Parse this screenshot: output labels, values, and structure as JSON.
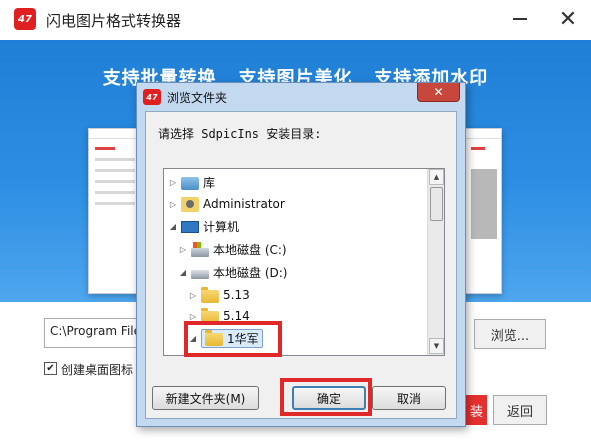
{
  "main_window": {
    "logo_text": "47",
    "title": "闪电图片格式转换器",
    "minimize_icon": "minimize-icon",
    "close_icon": "close-icon",
    "close_glyph": "✕",
    "banner": {
      "slogan": "支持批量转换   支持图片美化   支持添加水印"
    },
    "install_path": "C:\\Program File",
    "browse_label": "浏览...",
    "desktop_icon_checked": true,
    "desktop_icon_check_glyph": "✔",
    "desktop_icon_label": "创建桌面图标",
    "install_label": "装",
    "back_label": "返回",
    "accent_color": "#e53030",
    "banner_color": "#2d8ee3"
  },
  "browse_dialog": {
    "logo_text": "47",
    "title": "浏览文件夹",
    "close_glyph": "✕",
    "prompt": "请选择 SdpicIns 安装目录:",
    "tree": [
      {
        "expander": "▷",
        "icon": "library-icon",
        "label": "库"
      },
      {
        "expander": "▷",
        "icon": "user-folder-icon",
        "label": "Administrator"
      },
      {
        "expander": "◢",
        "icon": "computer-icon",
        "label": "计算机"
      },
      {
        "expander": "▷",
        "icon": "system-drive-icon",
        "label": "本地磁盘 (C:)"
      },
      {
        "expander": "◢",
        "icon": "drive-icon",
        "label": "本地磁盘 (D:)"
      },
      {
        "expander": "▷",
        "icon": "folder-icon",
        "label": "5.13"
      },
      {
        "expander": "▷",
        "icon": "folder-icon",
        "label": "5.14"
      },
      {
        "expander": "◢",
        "icon": "folder-icon",
        "label": "1华军",
        "selected": true
      }
    ],
    "scroll_up_glyph": "▲",
    "scroll_down_glyph": "▼",
    "new_folder_label": "新建文件夹(M)",
    "ok_label": "确定",
    "cancel_label": "取消",
    "highlight_color": "#e02828"
  }
}
